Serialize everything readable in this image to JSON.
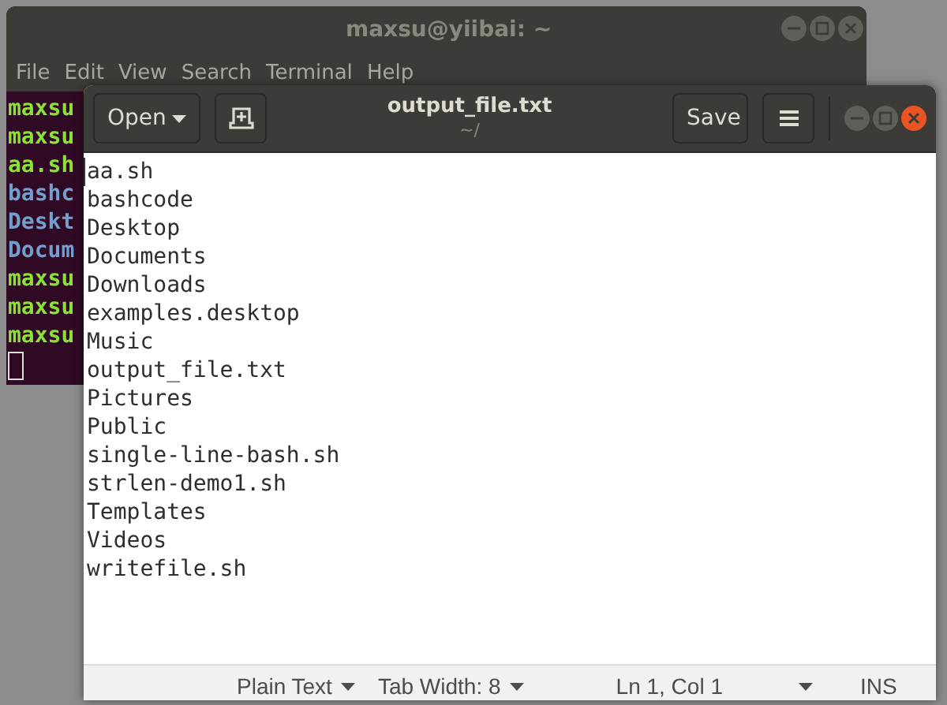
{
  "terminal": {
    "title": "maxsu@yiibai: ~",
    "menu": [
      "File",
      "Edit",
      "View",
      "Search",
      "Terminal",
      "Help"
    ],
    "lines": [
      {
        "text": "maxsu",
        "color": "#8ae234"
      },
      {
        "text": "maxsu",
        "color": "#8ae234"
      },
      {
        "text": "aa.sh",
        "color": "#8ae234"
      },
      {
        "text": "bashc",
        "color": "#729fcf"
      },
      {
        "text": "Deskt",
        "color": "#729fcf"
      },
      {
        "text": "Docum",
        "color": "#729fcf"
      },
      {
        "text": "maxsu",
        "color": "#8ae234"
      },
      {
        "text": "maxsu",
        "color": "#8ae234"
      },
      {
        "text": "maxsu",
        "color": "#8ae234"
      }
    ]
  },
  "editor": {
    "open_button": "Open",
    "save_button": "Save",
    "title": "output_file.txt",
    "subtitle": "~/",
    "lines": [
      "aa.sh",
      "bashcode",
      "Desktop",
      "Documents",
      "Downloads",
      "examples.desktop",
      "Music",
      "output_file.txt",
      "Pictures",
      "Public",
      "single-line-bash.sh",
      "strlen-demo1.sh",
      "Templates",
      "Videos",
      "writefile.sh"
    ],
    "status_bar": {
      "language": "Plain Text",
      "tab_width": "Tab Width: 8",
      "position": "Ln 1, Col 1",
      "mode": "INS"
    }
  }
}
